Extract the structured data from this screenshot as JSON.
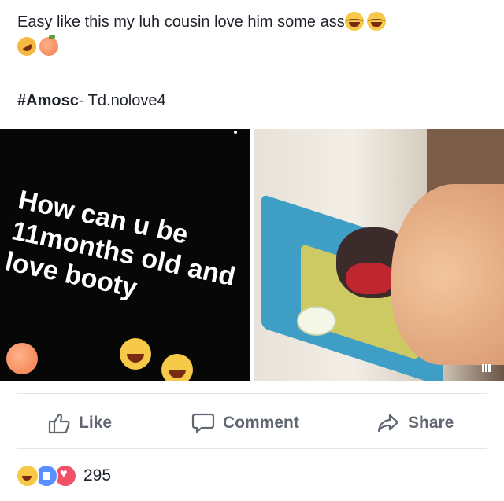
{
  "post": {
    "text": "Easy like this my luh cousin love him some ass",
    "hashtag": "#Amosc",
    "hashtag_suffix": "- Td.nolove4",
    "emojis_line1": [
      "laughing-tears",
      "laughing-tears"
    ],
    "emojis_line2": [
      "rolling-on-floor-laughing",
      "peach"
    ]
  },
  "media": {
    "left_caption": "How can u be 11months old and love booty",
    "right_image": "baby-photo"
  },
  "actions": {
    "like_label": "Like",
    "comment_label": "Comment",
    "share_label": "Share"
  },
  "reactions": {
    "types": [
      "haha",
      "like",
      "love"
    ],
    "count": "295"
  },
  "colors": {
    "action_text": "#616770",
    "like_blue": "#5890ff",
    "love_red": "#f25268"
  }
}
